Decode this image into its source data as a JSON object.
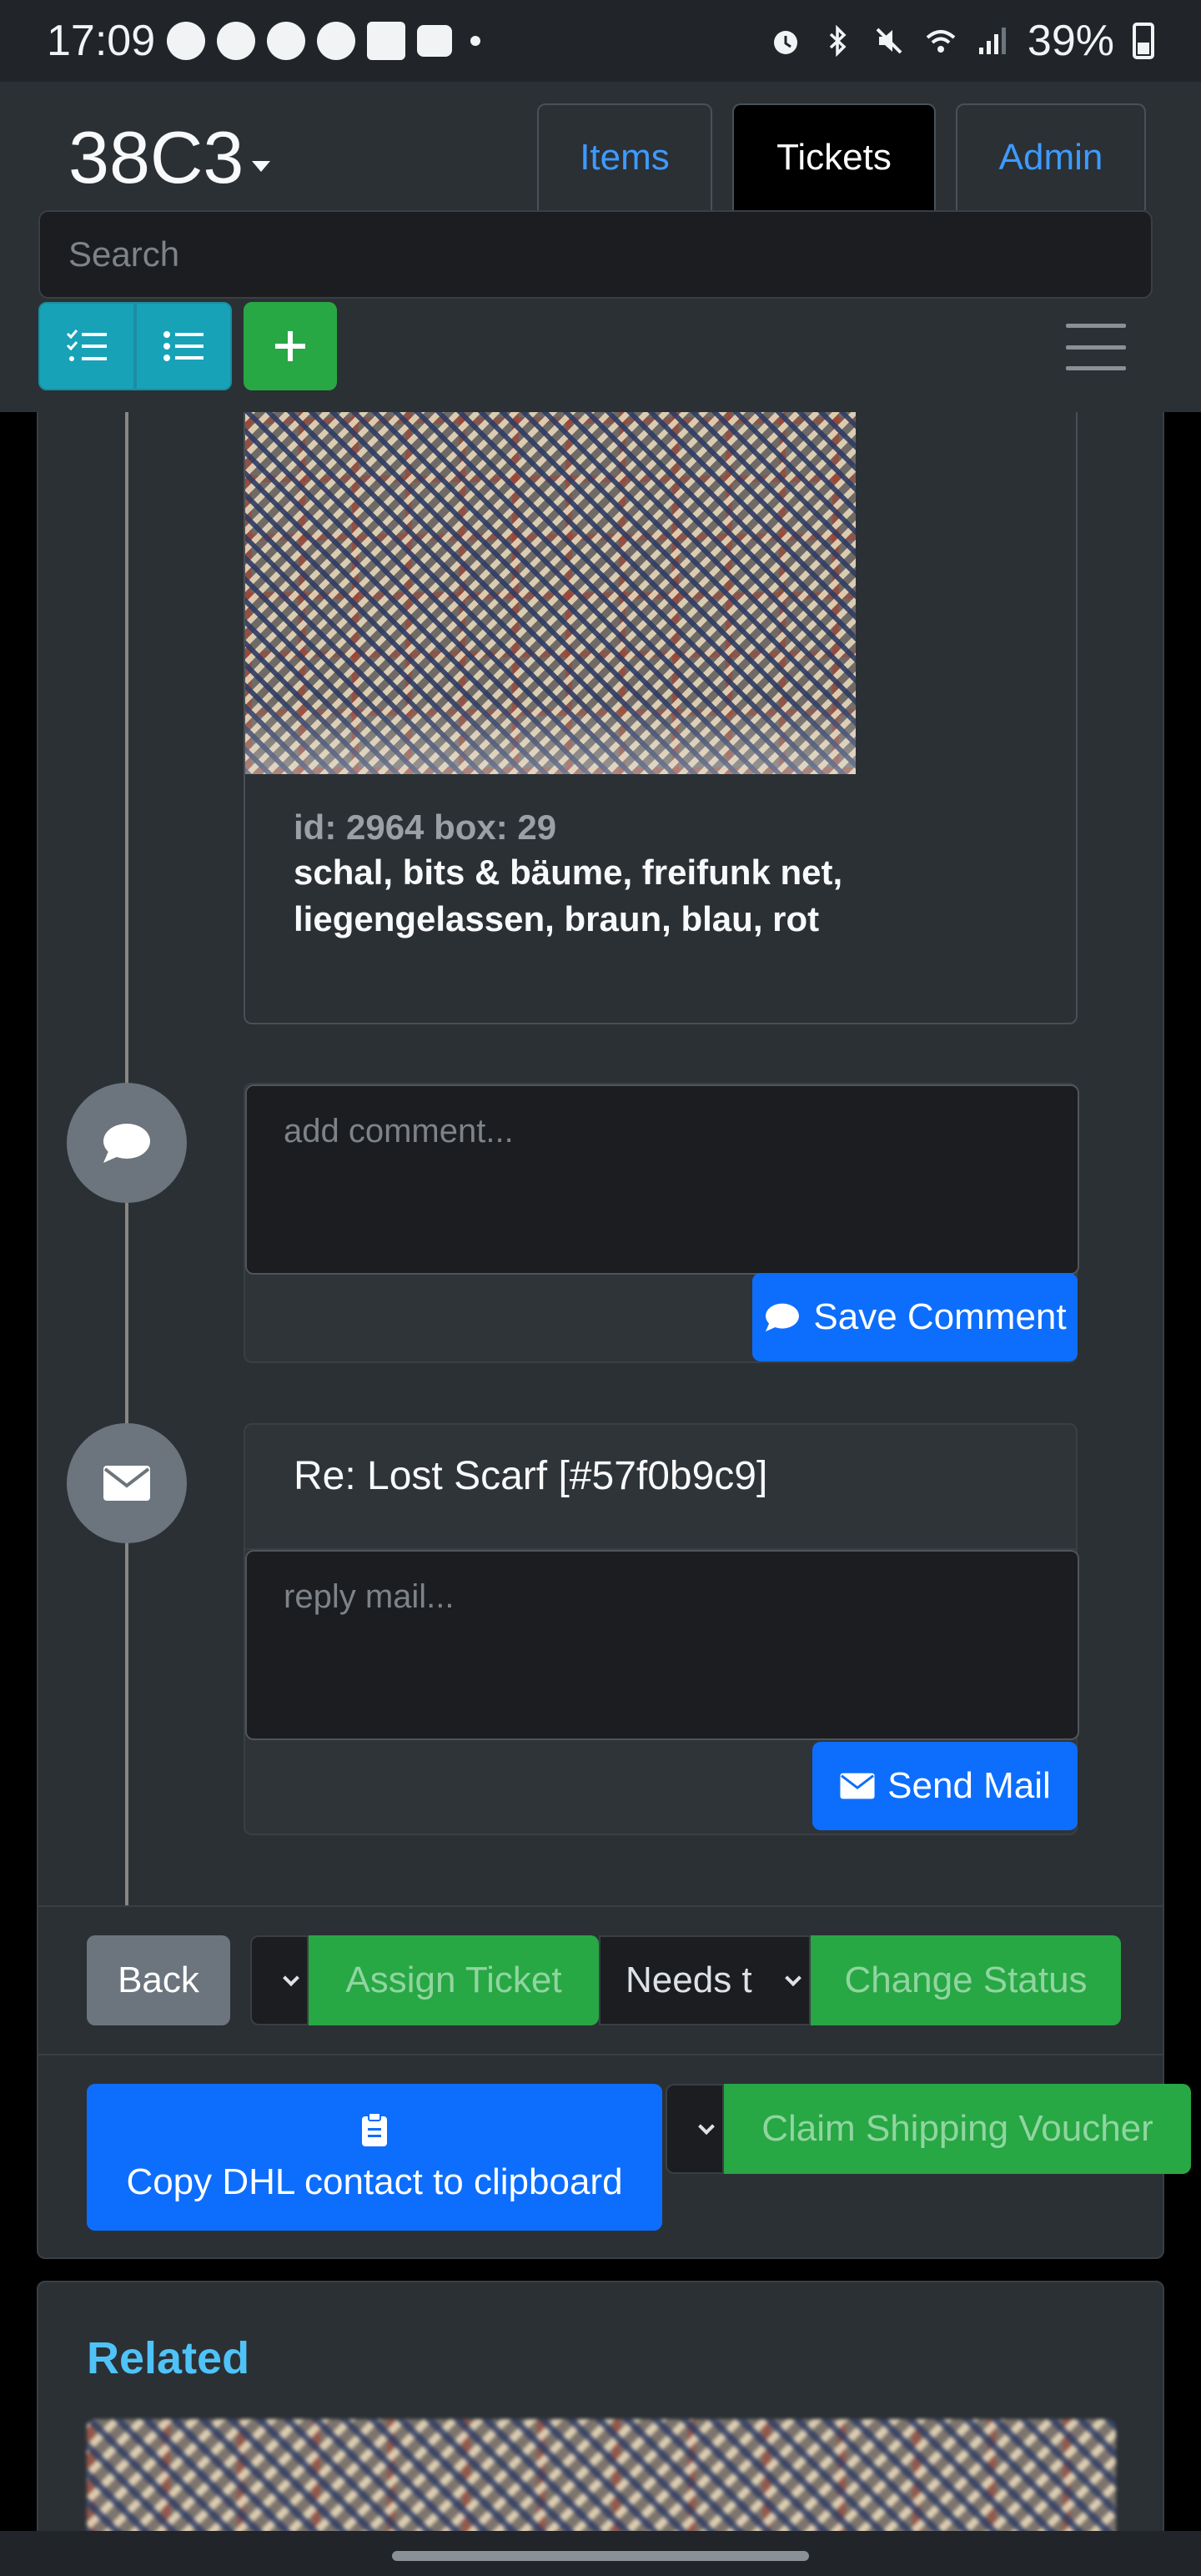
{
  "status_bar": {
    "time": "17:09",
    "battery": "39%",
    "icons": [
      "signal-app-icon",
      "lock-icon",
      "lock-icon",
      "lock-icon",
      "contact-icon",
      "keyboard-icon",
      "alarm-icon",
      "bluetooth-icon",
      "mute-icon",
      "wifi-icon",
      "cell-signal-icon",
      "battery-icon"
    ]
  },
  "navbar": {
    "brand": "38C3",
    "tabs": [
      {
        "label": "Items",
        "active": false
      },
      {
        "label": "Tickets",
        "active": true
      },
      {
        "label": "Admin",
        "active": false
      }
    ],
    "search_placeholder": "Search"
  },
  "item": {
    "id_line": "id: 2964 box: 29",
    "description": "schal, bits & bäume, freifunk net, liegengelassen, braun, blau, rot"
  },
  "comment": {
    "placeholder": "add comment...",
    "save_label": "Save Comment"
  },
  "mail": {
    "subject": "Re: Lost Scarf [#57f0b9c9]",
    "placeholder": "reply mail...",
    "send_label": "Send Mail"
  },
  "actions": {
    "back_label": "Back",
    "assign_label": "Assign Ticket",
    "status_value": "Needs t",
    "change_status_label": "Change Status",
    "copy_dhl_label": "Copy DHL contact to clipboard",
    "claim_voucher_label": "Claim Shipping Voucher"
  },
  "related": {
    "title": "Related"
  },
  "colors": {
    "primary": "#0d6efd",
    "success": "#28a745",
    "info": "#17a2b8",
    "secondary": "#6c757d",
    "related_title": "#4fc3f7"
  }
}
